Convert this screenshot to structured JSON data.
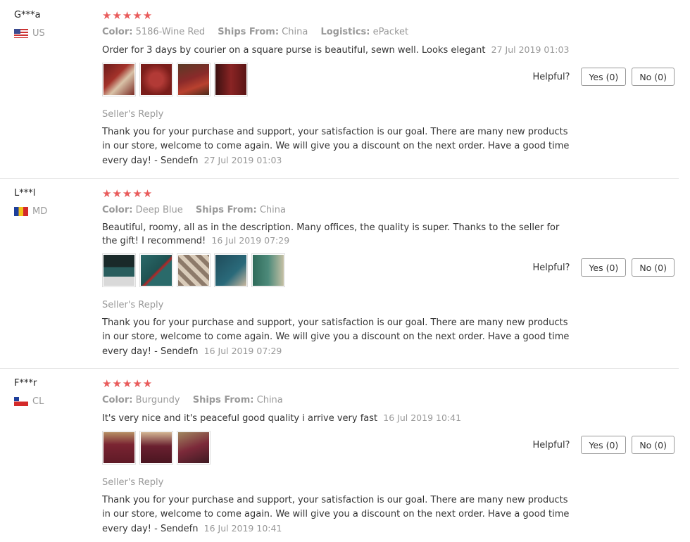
{
  "reviews": [
    {
      "user": "G***a",
      "country": "US",
      "stars": "★★★★★",
      "attrs": [
        {
          "label": "Color:",
          "value": "5186-Wine Red"
        },
        {
          "label": "Ships From:",
          "value": "China"
        },
        {
          "label": "Logistics:",
          "value": "ePacket"
        }
      ],
      "text": "Order for 3 days by courier on a square purse is beautiful, sewn well. Looks elegant",
      "date": "27 Jul 2019 01:03",
      "helpful_label": "Helpful?",
      "yes": "Yes (0)",
      "no": "No (0)",
      "reply_title": "Seller's Reply",
      "reply_text": "Thank you for your purchase and support, your satisfaction is our goal. There are many new products in our store, welcome to come again. We will give you a discount on the next order. Have a good time every day! - Sendefn",
      "reply_date": "27 Jul 2019 01:03"
    },
    {
      "user": "L***l",
      "country": "MD",
      "stars": "★★★★★",
      "attrs": [
        {
          "label": "Color:",
          "value": "Deep Blue"
        },
        {
          "label": "Ships From:",
          "value": "China"
        }
      ],
      "text": "Beautiful, roomy, all as in the description. Many offices, the quality is super. Thanks to the seller for the gift! I recommend!",
      "date": "16 Jul 2019 07:29",
      "helpful_label": "Helpful?",
      "yes": "Yes (0)",
      "no": "No (0)",
      "reply_title": "Seller's Reply",
      "reply_text": "Thank you for your purchase and support, your satisfaction is our goal. There are many new products in our store, welcome to come again. We will give you a discount on the next order. Have a good time every day! - Sendefn",
      "reply_date": "16 Jul 2019 07:29"
    },
    {
      "user": "F***r",
      "country": "CL",
      "stars": "★★★★★",
      "attrs": [
        {
          "label": "Color:",
          "value": "Burgundy"
        },
        {
          "label": "Ships From:",
          "value": "China"
        }
      ],
      "text": "It's very nice and it's peaceful good quality i arrive very fast",
      "date": "16 Jul 2019 10:41",
      "helpful_label": "Helpful?",
      "yes": "Yes (0)",
      "no": "No (0)",
      "reply_title": "Seller's Reply",
      "reply_text": "Thank you for your purchase and support, your satisfaction is our goal. There are many new products in our store, welcome to come again. We will give you a discount on the next order. Have a good time every day! - Sendefn",
      "reply_date": "16 Jul 2019 10:41"
    }
  ],
  "colors": {
    "star": "#e95b5b",
    "muted": "#999999",
    "divider": "#e8e8e8"
  }
}
